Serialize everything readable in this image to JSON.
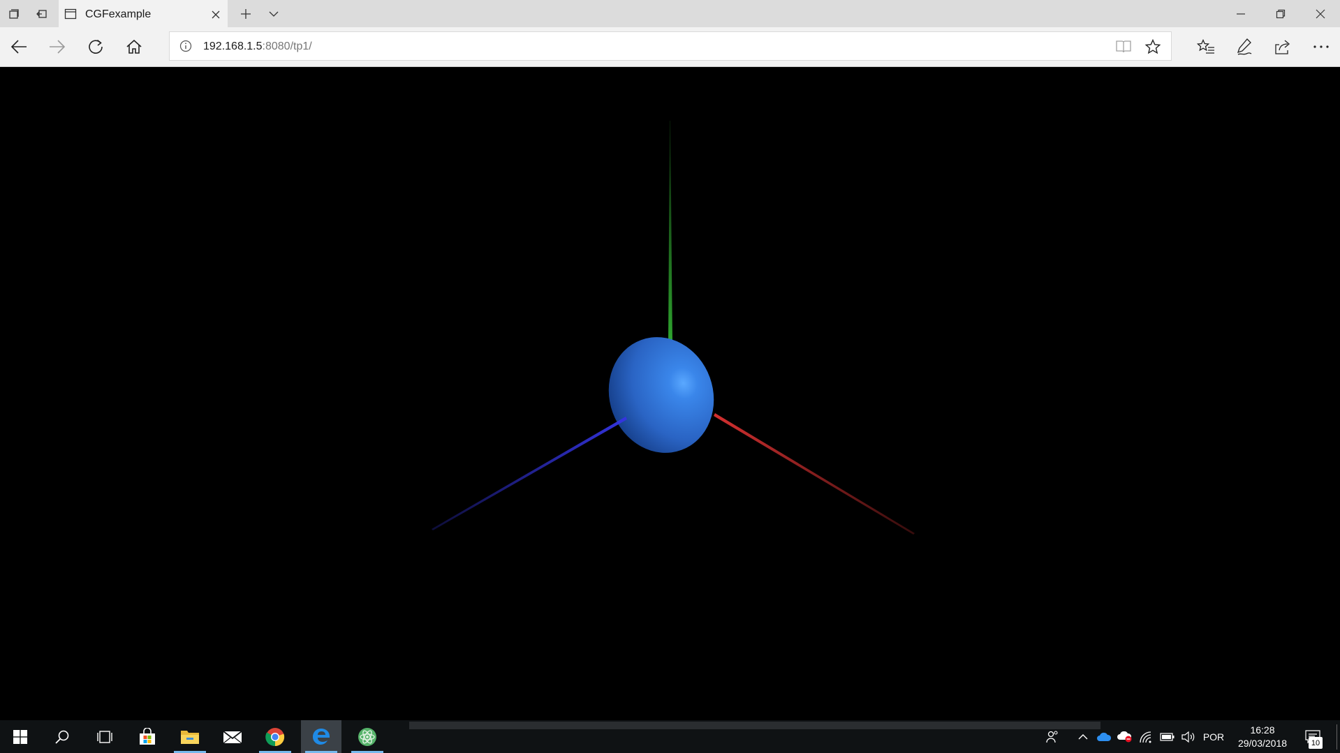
{
  "browser": {
    "tab": {
      "title": "CGFexample"
    },
    "address": {
      "host": "192.168.1.5",
      "rest": ":8080/tp1/"
    }
  },
  "scene": {
    "background": "#000000",
    "axes": {
      "x_color": "#d43030",
      "y_color": "#2fa52f",
      "z_color": "#3434e0"
    },
    "object": {
      "shape": "sphere",
      "color": "#2f73d8"
    }
  },
  "taskbar": {
    "apps": [
      "start-icon",
      "search-icon",
      "task-view-icon",
      "store-icon",
      "file-explorer-icon",
      "mail-icon",
      "chrome-icon",
      "edge-icon",
      "atom-icon"
    ],
    "language": "POR",
    "time": "16:28",
    "date": "29/03/2018",
    "notifications": "10"
  }
}
